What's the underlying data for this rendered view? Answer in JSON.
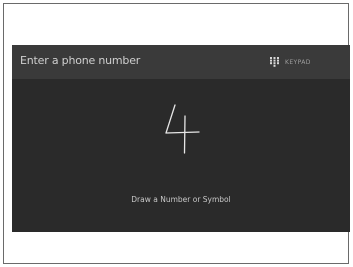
{
  "header": {
    "prompt": "Enter a phone number",
    "keypad_label": "KEYPAD",
    "keypad_icon": "keypad-grid-icon"
  },
  "canvas": {
    "recognized_character": "4",
    "instruction": "Draw a Number or Symbol"
  },
  "colors": {
    "screen_background": "#2a2a2a",
    "header_background": "#3a3a3a",
    "text_primary": "#cfcfcf",
    "text_secondary": "#9e9e9e"
  }
}
